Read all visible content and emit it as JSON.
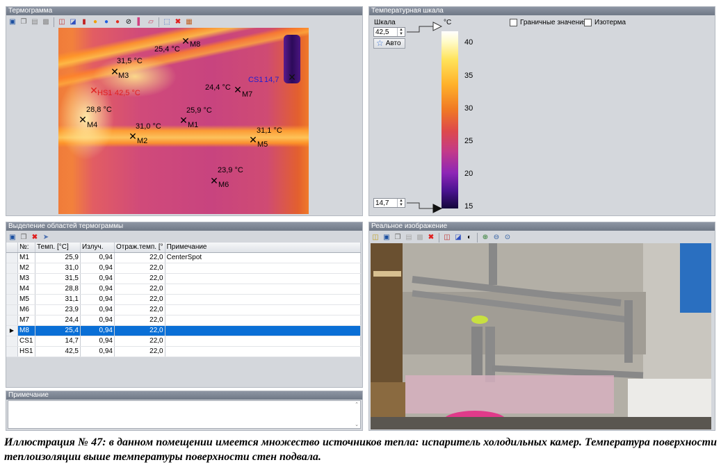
{
  "thermogram_panel": {
    "title": "Термограмма"
  },
  "markers": [
    {
      "id": "M8",
      "temp": "25,4 °C"
    },
    {
      "id": "M3",
      "temp": "31,5 °C"
    },
    {
      "id": "HS1",
      "temp": "42,5 °C"
    },
    {
      "id": "CS1",
      "temp": "14,7"
    },
    {
      "id": "M7",
      "temp": "24,4 °C"
    },
    {
      "id": "M4",
      "temp": "28,8 °C"
    },
    {
      "id": "M1",
      "temp": "25,9 °C"
    },
    {
      "id": "M2",
      "temp": "31,0 °C"
    },
    {
      "id": "M5",
      "temp": "31,1 °C"
    },
    {
      "id": "M6",
      "temp": "23,9 °C"
    }
  ],
  "scale_panel": {
    "title": "Температурная шкала",
    "scale_label": "Шкала",
    "max_value": "42,5",
    "min_value": "14,7",
    "auto_label": "Авто",
    "unit": "°C",
    "limits_label": "Граничные значения",
    "isotherm_label": "Изотерма",
    "ticks": [
      "40",
      "35",
      "30",
      "25",
      "20",
      "15"
    ]
  },
  "regions_panel": {
    "title": "Выделение областей термограммы",
    "columns": [
      "№:",
      "Темп. [°C]",
      "Излуч.",
      "Отраж.темп. [°",
      "Примечание"
    ],
    "rows": [
      {
        "n": "M1",
        "temp": "25,9",
        "emis": "0,94",
        "refl": "22,0",
        "note": "CenterSpot"
      },
      {
        "n": "M2",
        "temp": "31,0",
        "emis": "0,94",
        "refl": "22,0",
        "note": ""
      },
      {
        "n": "M3",
        "temp": "31,5",
        "emis": "0,94",
        "refl": "22,0",
        "note": ""
      },
      {
        "n": "M4",
        "temp": "28,8",
        "emis": "0,94",
        "refl": "22,0",
        "note": ""
      },
      {
        "n": "M5",
        "temp": "31,1",
        "emis": "0,94",
        "refl": "22,0",
        "note": ""
      },
      {
        "n": "M6",
        "temp": "23,9",
        "emis": "0,94",
        "refl": "22,0",
        "note": ""
      },
      {
        "n": "M7",
        "temp": "24,4",
        "emis": "0,94",
        "refl": "22,0",
        "note": ""
      },
      {
        "n": "M8",
        "temp": "25,4",
        "emis": "0,94",
        "refl": "22,0",
        "note": ""
      },
      {
        "n": "CS1",
        "temp": "14,7",
        "emis": "0,94",
        "refl": "22,0",
        "note": ""
      },
      {
        "n": "HS1",
        "temp": "42,5",
        "emis": "0,94",
        "refl": "22,0",
        "note": ""
      }
    ],
    "selected_row": "M8"
  },
  "notes_panel": {
    "title": "Примечание"
  },
  "photo_panel": {
    "title": "Реальное изображение"
  },
  "caption": "Иллюстрация № 47: в данном помещении имеется множество источников тепла: испаритель холодильных камер. Температура поверхности теплоизоляции выше температуры поверхности стен подвала.",
  "colors": {
    "selection": "#0a6fd6",
    "hot_marker": "#e02020",
    "cold_marker": "#2020d0"
  }
}
